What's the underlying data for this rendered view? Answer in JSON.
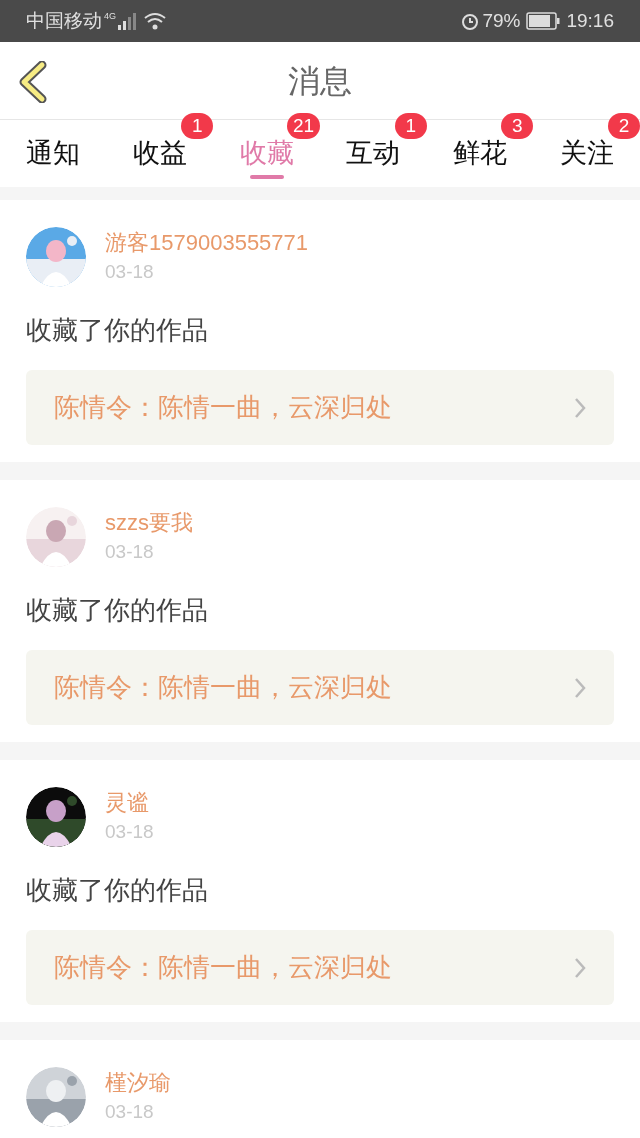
{
  "status_bar": {
    "carrier": "中国移动",
    "network": "4G",
    "battery": "79%",
    "time": "19:16"
  },
  "header": {
    "title": "消息"
  },
  "tabs": [
    {
      "label": "通知",
      "selected": false
    },
    {
      "label": "收益",
      "selected": false,
      "badge": "1"
    },
    {
      "label": "收藏",
      "selected": true,
      "badge": "21"
    },
    {
      "label": "互动",
      "selected": false,
      "badge": "1"
    },
    {
      "label": "鲜花",
      "selected": false,
      "badge": "3"
    },
    {
      "label": "关注",
      "selected": false,
      "badge": "2"
    }
  ],
  "messages": [
    {
      "user": "游客1579003555771",
      "date": "03-18",
      "action": "收藏了你的作品",
      "work": "陈情令：陈情一曲，云深归处"
    },
    {
      "user": "szzs要我",
      "date": "03-18",
      "action": "收藏了你的作品",
      "work": "陈情令：陈情一曲，云深归处"
    },
    {
      "user": "灵谧",
      "date": "03-18",
      "action": "收藏了你的作品",
      "work": "陈情令：陈情一曲，云深归处"
    },
    {
      "user": "槿汐瑜",
      "date": "03-18"
    }
  ]
}
